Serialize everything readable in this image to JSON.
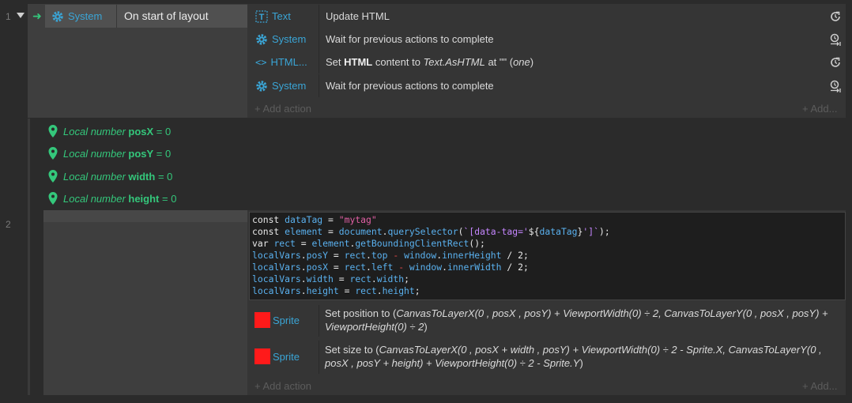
{
  "event1": {
    "number": "1",
    "condition": {
      "object": "System",
      "text": "On start of layout"
    },
    "actions": [
      {
        "object": "Text",
        "icon": "text-icon",
        "text": "Update HTML",
        "right_icon": "refresh-icon"
      },
      {
        "object": "System",
        "icon": "gear-icon",
        "text": "Wait for previous actions to complete",
        "right_icon": "wait-icon"
      },
      {
        "object": "HTML...",
        "icon": "code-icon",
        "text_prefix": "Set ",
        "text_bold": "HTML",
        "text_mid": " content to ",
        "text_italic": "Text.AsHTML",
        "text_after": " at \"\" (",
        "text_italic2": "one",
        "text_end": ")",
        "right_icon": "refresh-icon"
      },
      {
        "object": "System",
        "icon": "gear-icon",
        "text": "Wait for previous actions to complete",
        "right_icon": "wait-icon"
      }
    ],
    "add_action": "+ Add action",
    "add_more": "+ Add..."
  },
  "locals": [
    {
      "prefix": "Local number ",
      "name": "posX",
      "value": " = 0"
    },
    {
      "prefix": "Local number ",
      "name": "posY",
      "value": " = 0"
    },
    {
      "prefix": "Local number ",
      "name": "width",
      "value": " = 0"
    },
    {
      "prefix": "Local number ",
      "name": "height",
      "value": " = 0"
    }
  ],
  "event2": {
    "number": "2",
    "script_lines": [
      "const dataTag = \"mytag\"",
      "const element = document.querySelector(`[data-tag='${dataTag}']`);",
      "var rect = element.getBoundingClientRect();",
      "localVars.posY = rect.top - window.innerHeight / 2;",
      "localVars.posX = rect.left - window.innerWidth / 2;",
      "localVars.width = rect.width;",
      "localVars.height = rect.height;"
    ],
    "sprite_actions": [
      {
        "object": "Sprite",
        "prefix": "Set position to (",
        "expr": "CanvasToLayerX(0 , posX , posY) + ViewportWidth(0) ÷ 2, CanvasToLayerY(0 , posX , posY) + ViewportHeight(0) ÷ 2",
        "suffix": ")"
      },
      {
        "object": "Sprite",
        "prefix": "Set size to (",
        "expr": "CanvasToLayerX(0 , posX + width , posY) + ViewportWidth(0) ÷ 2 - Sprite.X, CanvasToLayerY(0 , posX , posY + height) + ViewportHeight(0) ÷ 2 - Sprite.Y",
        "suffix": ")"
      }
    ],
    "add_action": "+ Add action",
    "add_more": "+ Add..."
  },
  "colors": {
    "accent": "#3aa5d6",
    "local_var": "#34c77b",
    "sprite_swatch": "#ff1a1a"
  }
}
